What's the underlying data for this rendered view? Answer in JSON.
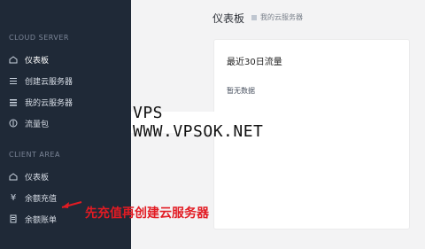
{
  "colors": {
    "sidebar_bg": "#1f2937",
    "content_bg": "#f3f3f4",
    "card_bg": "#ffffff",
    "annotation_red": "#e21b23"
  },
  "header": {
    "title": "仪表板",
    "breadcrumb": "我的云服务器"
  },
  "sidebar": {
    "section_cloud": "CLOUD SERVER",
    "items_cloud": [
      {
        "label": "仪表板",
        "icon": "dashboard-icon"
      },
      {
        "label": "创建云服务器",
        "icon": "list-icon"
      },
      {
        "label": "我的云服务器",
        "icon": "server-list-icon"
      },
      {
        "label": "流量包",
        "icon": "traffic-pack-icon"
      }
    ],
    "section_client": "CLIENT AREA",
    "items_client": [
      {
        "label": "仪表板",
        "icon": "dashboard-icon"
      },
      {
        "label": "余额充值",
        "icon": "yen-icon"
      },
      {
        "label": "余额账单",
        "icon": "bill-icon"
      }
    ]
  },
  "card": {
    "title": "最近30日流量",
    "empty_text": "暂无数据"
  },
  "watermark": {
    "text": "VPS WWW.VPSOK.NET"
  },
  "annotation": {
    "text": "先充值再创建云服务器"
  }
}
